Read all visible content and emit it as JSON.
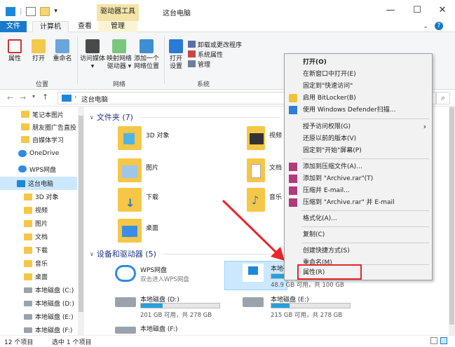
{
  "window": {
    "contextual_tab": "驱动器工具",
    "title": "这台电脑",
    "min": "—",
    "max": "☐",
    "close": "✕"
  },
  "tabs": {
    "file": "文件",
    "computer": "计算机",
    "view": "查看",
    "manage": "管理"
  },
  "ribbon": {
    "props": "属性",
    "open": "打开",
    "rename": "重命名",
    "access_media_1": "访问媒体",
    "map_drive_1": "映射网络",
    "map_drive_2": "驱动器",
    "add_loc_1": "添加一个",
    "add_loc_2": "网络位置",
    "open_settings_1": "打开",
    "open_settings_2": "设置",
    "uninstall": "卸载或更改程序",
    "sys_props": "系统属性",
    "manage": "管理",
    "group_location": "位置",
    "group_network": "网络",
    "group_system": "系统"
  },
  "address": {
    "back": "←",
    "forward": "→",
    "up": "↑",
    "path": "这台电脑",
    "search_icon": "⌕"
  },
  "nav": [
    {
      "label": "笔记本图片",
      "kind": "folder"
    },
    {
      "label": "朋友圈广告直投",
      "kind": "folder"
    },
    {
      "label": "自媒体学习",
      "kind": "folder"
    },
    {
      "label": "OneDrive",
      "kind": "cloud"
    },
    {
      "label": "WPS网盘",
      "kind": "cloud"
    },
    {
      "label": "这台电脑",
      "kind": "pc"
    },
    {
      "label": "3D 对象",
      "kind": "folder"
    },
    {
      "label": "视频",
      "kind": "folder"
    },
    {
      "label": "图片",
      "kind": "folder"
    },
    {
      "label": "文档",
      "kind": "folder"
    },
    {
      "label": "下载",
      "kind": "folder"
    },
    {
      "label": "音乐",
      "kind": "folder"
    },
    {
      "label": "桌面",
      "kind": "folder"
    },
    {
      "label": "本地磁盘 (C:)",
      "kind": "drive"
    },
    {
      "label": "本地磁盘 (D:)",
      "kind": "drive"
    },
    {
      "label": "本地磁盘 (E:)",
      "kind": "drive"
    },
    {
      "label": "本地磁盘 (F:)",
      "kind": "drive"
    }
  ],
  "content": {
    "folders_header": "文件夹 (7)",
    "devices_header": "设备和驱动器 (5)",
    "folders": [
      "3D 对象",
      "视频",
      "图片",
      "文档",
      "下载",
      "音乐",
      "桌面"
    ],
    "wps_name": "WPS网盘",
    "wps_sub": "双击进入WPS网盘",
    "drive_c_name": "本地磁盘 (C:)",
    "drive_c_free": "48.9 GB 可用，共 100 GB",
    "drive_c_used": 0.51,
    "drive_d_name": "本地磁盘 (D:)",
    "drive_d_free": "201 GB 可用，共 278 GB",
    "drive_d_used": 0.28,
    "drive_e_name": "本地磁盘 (E:)",
    "drive_e_free": "215 GB 可用，共 278 GB",
    "drive_e_used": 0.23,
    "drive_f_name": "本地磁盘 (F:)"
  },
  "status": {
    "count": "12 个项目",
    "selected": "选中 1 个项目"
  },
  "menu": {
    "open": "打开(O)",
    "open_new": "在新窗口中打开(E)",
    "pin_quick": "固定到\"快速访问\"",
    "bitlocker": "启用 BitLocker(B)",
    "defender": "使用 Windows Defender扫描...",
    "grant": "授予访问权限(G)",
    "restore": "还原以前的版本(V)",
    "pin_start": "固定到\"开始\"屏幕(P)",
    "add_archive": "添加到压缩文件(A)...",
    "add_rar": "添加到 \"Archive.rar\"(T)",
    "zip_email": "压缩并 E-mail...",
    "zip_rar_email": "压缩到 \"Archive.rar\" 并 E-mail",
    "format": "格式化(A)...",
    "copy": "复制(C)",
    "shortcut": "创建快捷方式(S)",
    "rename": "重命名(M)",
    "properties": "属性(R)",
    "submenu_arrow": "›"
  },
  "colors": {
    "accent": "#1979ca",
    "drive_fill": "#26a0da",
    "highlight_red": "#e8262c",
    "folder": "#f6c647"
  }
}
